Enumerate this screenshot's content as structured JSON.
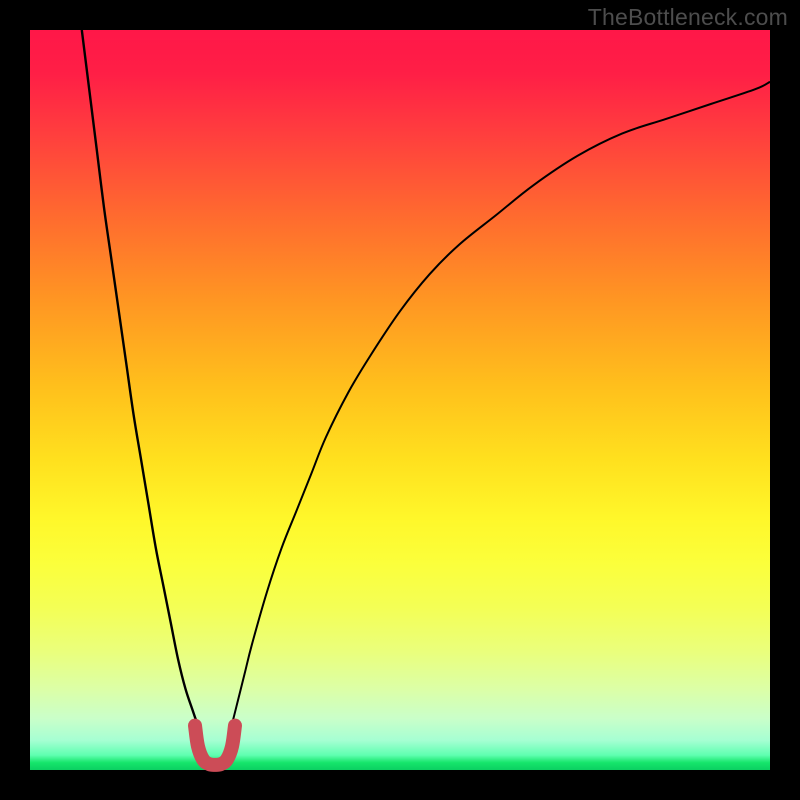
{
  "watermark": "TheBottleneck.com",
  "chart_data": {
    "type": "line",
    "title": "",
    "xlabel": "",
    "ylabel": "",
    "xlim": [
      0,
      100
    ],
    "ylim": [
      0,
      100
    ],
    "grid": false,
    "legend": false,
    "background_gradient_stops": [
      {
        "pct": 0,
        "color": "#ff1748"
      },
      {
        "pct": 25,
        "color": "#ff6a2f"
      },
      {
        "pct": 50,
        "color": "#ffcc1d"
      },
      {
        "pct": 72,
        "color": "#fbff3b"
      },
      {
        "pct": 90,
        "color": "#d8ffb8"
      },
      {
        "pct": 100,
        "color": "#0bd062"
      }
    ],
    "series": [
      {
        "name": "left-branch-curve",
        "color": "#000000",
        "x": [
          7,
          8,
          9,
          10,
          11,
          12,
          13,
          14,
          15,
          16,
          17,
          18,
          19,
          20,
          21,
          22,
          23,
          23.5
        ],
        "y": [
          100,
          92,
          84,
          76,
          69,
          62,
          55,
          48,
          42,
          36,
          30,
          25,
          20,
          15,
          11,
          8,
          5,
          3
        ]
      },
      {
        "name": "right-branch-curve",
        "color": "#000000",
        "x": [
          26.5,
          27,
          28,
          29,
          30,
          32,
          34,
          36,
          38,
          40,
          43,
          46,
          50,
          54,
          58,
          63,
          68,
          74,
          80,
          86,
          92,
          98,
          100
        ],
        "y": [
          3,
          5,
          9,
          13,
          17,
          24,
          30,
          35,
          40,
          45,
          51,
          56,
          62,
          67,
          71,
          75,
          79,
          83,
          86,
          88,
          90,
          92,
          93
        ]
      },
      {
        "name": "sweet-spot-u-marker",
        "color": "#cc4c57",
        "x": [
          22.3,
          22.7,
          23.4,
          24.2,
          25.0,
          25.8,
          26.6,
          27.3,
          27.7
        ],
        "y": [
          6.0,
          3.2,
          1.4,
          0.8,
          0.7,
          0.8,
          1.4,
          3.2,
          6.0
        ]
      }
    ],
    "styles": {
      "left-branch-curve": {
        "stroke_width": 2.4,
        "linecap": "butt"
      },
      "right-branch-curve": {
        "stroke_width": 2.0,
        "linecap": "butt"
      },
      "sweet-spot-u-marker": {
        "stroke_width": 14,
        "linecap": "round"
      }
    }
  }
}
